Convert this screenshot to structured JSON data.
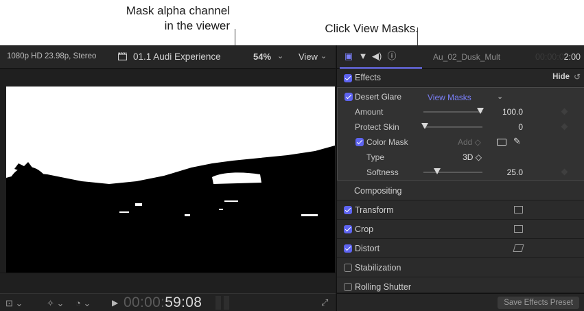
{
  "callouts": {
    "left_line1": "Mask alpha channel",
    "left_line2": "in the viewer",
    "right": "Click View Masks."
  },
  "viewer": {
    "format": "1080p HD 23.98p, Stereo",
    "project": "01.1 Audi Experience",
    "zoom": "54%",
    "view_label": "View",
    "timecode_dim": "00:00:",
    "timecode_bright": "59:08"
  },
  "inspector": {
    "clip_name": "Au_02_Dusk_Mult",
    "duration_dim": "00:00:0",
    "duration_bright": "2:00",
    "effects_label": "Effects",
    "hide_label": "Hide",
    "effect": {
      "name": "Desert Glare",
      "view_masks": "View Masks",
      "params": [
        {
          "label": "Amount",
          "value": "100.0",
          "level": 1.0
        },
        {
          "label": "Protect Skin",
          "value": "0",
          "level": 0.0
        }
      ],
      "color_mask": {
        "label": "Color Mask",
        "add": "Add ◇",
        "type_label": "Type",
        "type_value": "3D ◇",
        "softness_label": "Softness",
        "softness_value": "25.0",
        "softness_level": 0.25
      }
    },
    "compositing_label": "Compositing",
    "properties": [
      {
        "label": "Transform",
        "checked": true
      },
      {
        "label": "Crop",
        "checked": true
      },
      {
        "label": "Distort",
        "checked": true
      },
      {
        "label": "Stabilization",
        "checked": false
      },
      {
        "label": "Rolling Shutter",
        "checked": false
      }
    ],
    "save_preset": "Save Effects Preset"
  },
  "colors": {
    "accent": "#5e64f0",
    "link": "#7a7ff8"
  }
}
